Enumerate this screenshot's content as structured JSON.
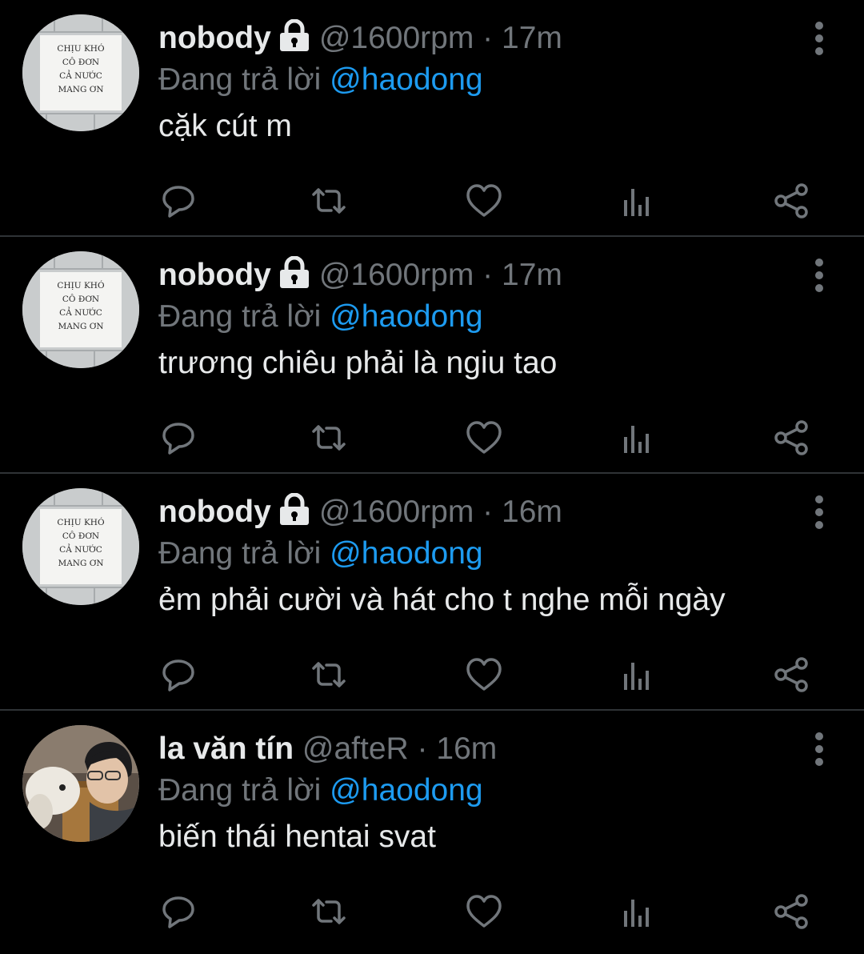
{
  "colors": {
    "background": "#000000",
    "text_primary": "#e7e9ea",
    "text_secondary": "#71767b",
    "mention": "#1d9bf0",
    "divider": "#2f3336"
  },
  "tweets": [
    {
      "avatar": {
        "kind": "sign-photo",
        "sign_lines": [
          "CHỊU KHÓ",
          "CÔ ĐƠN",
          "CẢ NƯỚC",
          "MANG ƠN"
        ]
      },
      "display_name": "nobody",
      "protected": true,
      "handle": "@1600rpm",
      "separator": "·",
      "time": "17m",
      "reply_prefix": "Đang trả lời",
      "reply_to": "@haodong",
      "text": "cặk cút m",
      "actions": [
        "reply-icon",
        "retweet-icon",
        "like-icon",
        "views-icon",
        "share-icon"
      ]
    },
    {
      "avatar": {
        "kind": "sign-photo",
        "sign_lines": [
          "CHỊU KHÓ",
          "CÔ ĐƠN",
          "CẢ NƯỚC",
          "MANG ƠN"
        ]
      },
      "display_name": "nobody",
      "protected": true,
      "handle": "@1600rpm",
      "separator": "·",
      "time": "17m",
      "reply_prefix": "Đang trả lời",
      "reply_to": "@haodong",
      "text": "trương chiêu phải là ngiu tao",
      "actions": [
        "reply-icon",
        "retweet-icon",
        "like-icon",
        "views-icon",
        "share-icon"
      ]
    },
    {
      "avatar": {
        "kind": "sign-photo",
        "sign_lines": [
          "CHỊU KHÓ",
          "CÔ ĐƠN",
          "CẢ NƯỚC",
          "MANG ƠN"
        ]
      },
      "display_name": "nobody",
      "protected": true,
      "handle": "@1600rpm",
      "separator": "·",
      "time": "16m",
      "reply_prefix": "Đang trả lời",
      "reply_to": "@haodong",
      "text": "ẻm phải cười và hát cho t nghe mỗi ngày",
      "actions": [
        "reply-icon",
        "retweet-icon",
        "like-icon",
        "views-icon",
        "share-icon"
      ]
    },
    {
      "avatar": {
        "kind": "person-with-dog-photo"
      },
      "display_name": "la văn tín",
      "protected": false,
      "handle": "@afteR",
      "separator": "·",
      "time": "16m",
      "reply_prefix": "Đang trả lời",
      "reply_to": "@haodong",
      "text": "biến thái hentai svat",
      "actions": [
        "reply-icon",
        "retweet-icon",
        "like-icon",
        "views-icon",
        "share-icon"
      ]
    }
  ]
}
